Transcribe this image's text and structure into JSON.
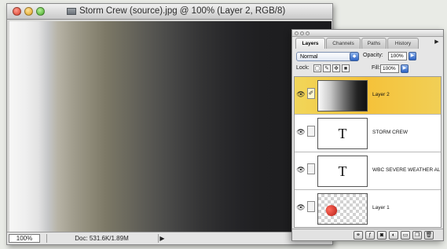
{
  "document": {
    "title": "Storm Crew (source).jpg @ 100% (Layer 2, RGB/8)",
    "zoom": "100%",
    "doc_info": "Doc: 531.6K/1.89M"
  },
  "layers_panel": {
    "tabs": [
      "Layers",
      "Channels",
      "Paths",
      "History"
    ],
    "active_tab": "Layers",
    "blend_mode": "Normal",
    "opacity_label": "Opacity:",
    "opacity": "100%",
    "lock_label": "Lock:",
    "fill_label": "Fill:",
    "fill": "100%",
    "layers": [
      {
        "name": "Layer 2",
        "thumbnail": "gradient",
        "selected": true
      },
      {
        "name": "STORM CREW",
        "thumbnail": "text",
        "selected": false
      },
      {
        "name": "WBC SEVERE WEATHER AL...",
        "thumbnail": "text",
        "selected": false
      },
      {
        "name": "Layer 1",
        "thumbnail": "checker",
        "selected": false
      }
    ],
    "selection_color": "#f5c23a"
  },
  "icons": {
    "eye": "eye-icon",
    "brush": "brush-icon",
    "text_thumb": "T",
    "footer": [
      "link-layers-icon",
      "layer-style-icon",
      "mask-icon",
      "adjustment-layer-icon",
      "new-group-icon",
      "new-layer-icon",
      "trash-icon"
    ]
  }
}
